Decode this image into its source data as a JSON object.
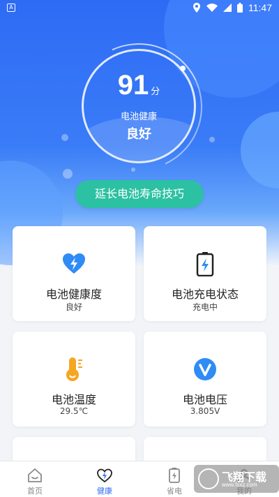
{
  "status_bar": {
    "time": "11:47",
    "left_icon": "A"
  },
  "health": {
    "score": "91",
    "score_unit": "分",
    "label": "电池健康",
    "value": "良好"
  },
  "tips_button": {
    "label": "延长电池寿命技巧"
  },
  "cards": [
    {
      "title": "电池健康度",
      "value": "良好",
      "icon": "heart-bolt-icon",
      "color": "#2f8cf4"
    },
    {
      "title": "电池充电状态",
      "value": "充电中",
      "icon": "battery-charging-icon",
      "color": "#2f8cf4"
    },
    {
      "title": "电池温度",
      "value": "29.5℃",
      "icon": "thermometer-icon",
      "color": "#f5a623"
    },
    {
      "title": "电池电压",
      "value": "3.805V",
      "icon": "voltage-icon",
      "color": "#2f8cf4"
    }
  ],
  "tabs": [
    {
      "label": "首页",
      "icon": "home-icon",
      "active": false
    },
    {
      "label": "健康",
      "icon": "heart-bolt-icon",
      "active": true
    },
    {
      "label": "省电",
      "icon": "battery-icon",
      "active": false
    },
    {
      "label": "我的",
      "icon": "profile-icon",
      "active": false
    }
  ],
  "watermark": {
    "text": "飞翔下载",
    "url": "www.fxxz.com"
  },
  "colors": {
    "primary": "#2f6cf4",
    "accent": "#2cc1a2",
    "background": "#f2f4f8"
  }
}
